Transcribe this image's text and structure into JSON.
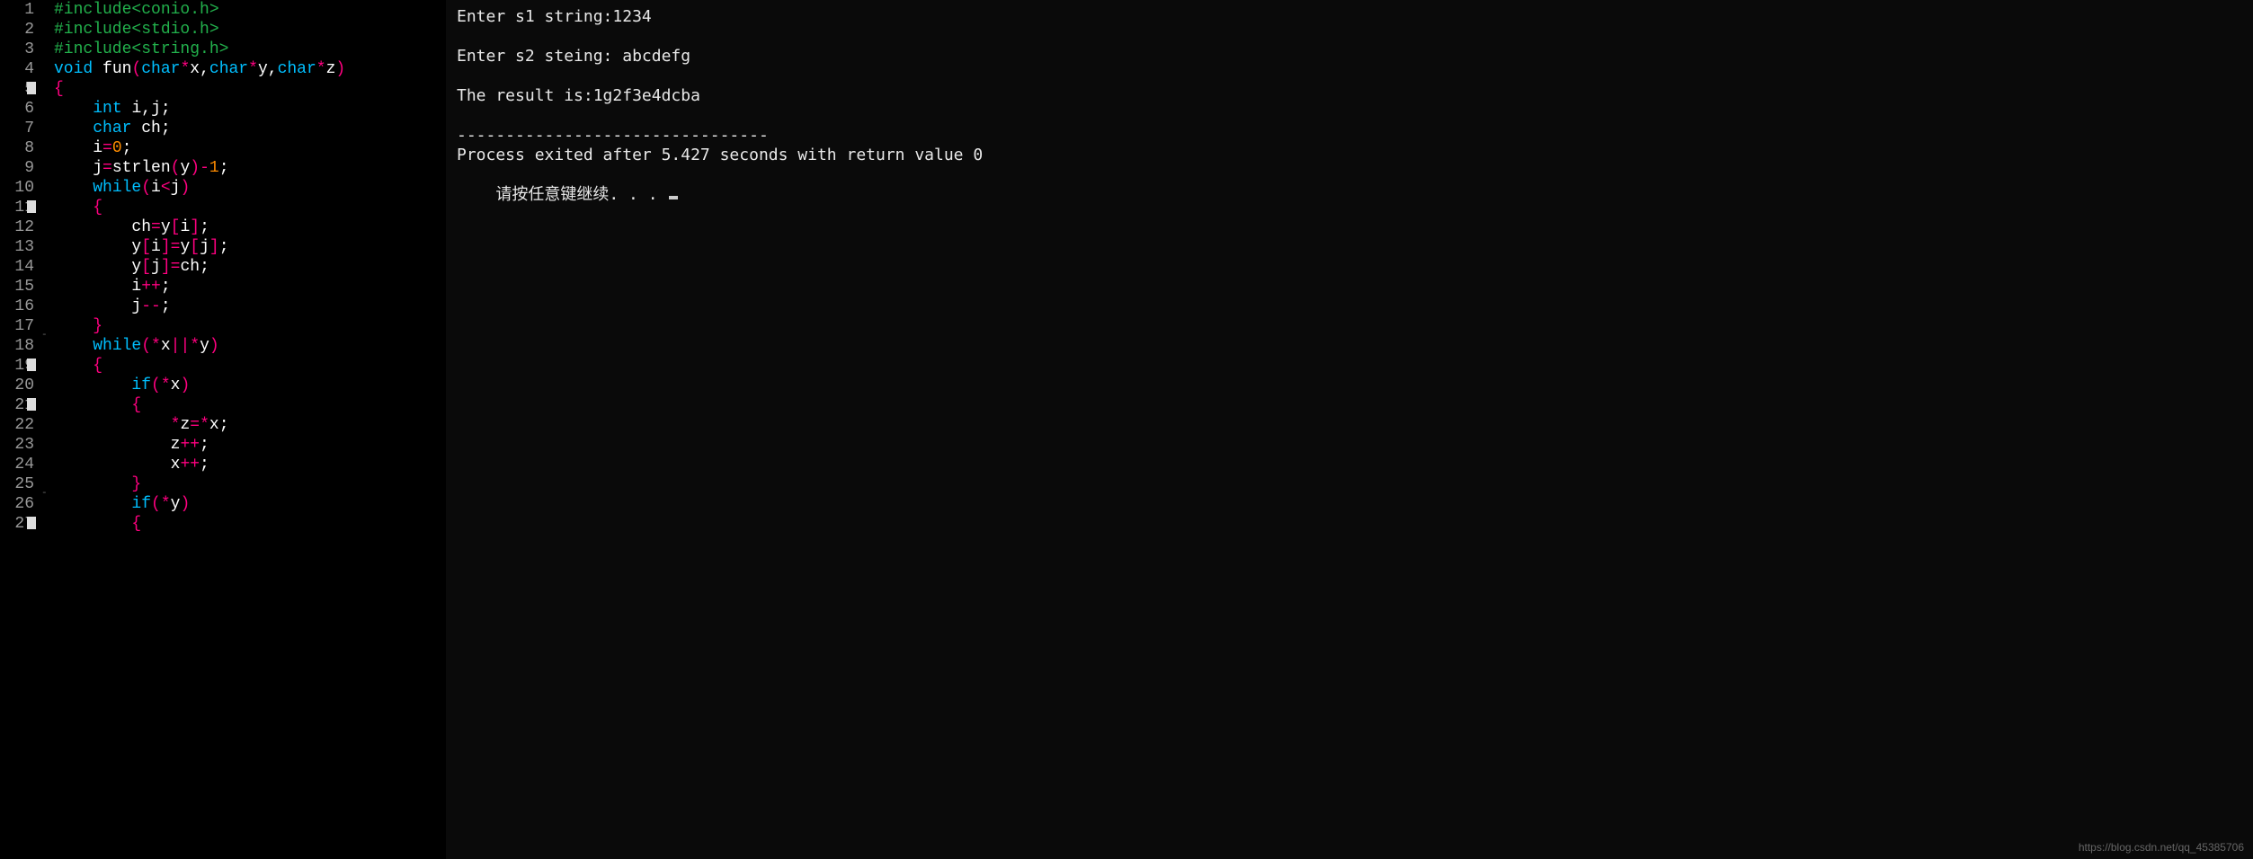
{
  "editor": {
    "lines": [
      {
        "num": "1",
        "tokens": [
          [
            "tok-preproc",
            "#include"
          ],
          [
            "tok-preproc-lib",
            "<conio.h>"
          ]
        ]
      },
      {
        "num": "2",
        "tokens": [
          [
            "tok-preproc",
            "#include"
          ],
          [
            "tok-preproc-lib",
            "<stdio.h>"
          ]
        ]
      },
      {
        "num": "3",
        "tokens": [
          [
            "tok-preproc",
            "#include"
          ],
          [
            "tok-preproc-lib",
            "<string.h>"
          ]
        ]
      },
      {
        "num": "4",
        "tokens": [
          [
            "tok-keyword",
            "void"
          ],
          [
            "",
            " "
          ],
          [
            "tok-func",
            "fun"
          ],
          [
            "tok-bracket",
            "("
          ],
          [
            "tok-type",
            "char"
          ],
          [
            "tok-op",
            "*"
          ],
          [
            "tok-ident",
            "x"
          ],
          [
            "tok-punct",
            ","
          ],
          [
            "tok-type",
            "char"
          ],
          [
            "tok-op",
            "*"
          ],
          [
            "tok-ident",
            "y"
          ],
          [
            "tok-punct",
            ","
          ],
          [
            "tok-type",
            "char"
          ],
          [
            "tok-op",
            "*"
          ],
          [
            "tok-ident",
            "z"
          ],
          [
            "tok-bracket",
            ")"
          ]
        ]
      },
      {
        "num": "5",
        "fold": true,
        "tokens": [
          [
            "tok-bracket",
            "{"
          ]
        ]
      },
      {
        "num": "6",
        "tokens": [
          [
            "",
            "    "
          ],
          [
            "tok-type",
            "int"
          ],
          [
            "",
            " "
          ],
          [
            "tok-ident",
            "i"
          ],
          [
            "tok-punct",
            ","
          ],
          [
            "tok-ident",
            "j"
          ],
          [
            "tok-punct",
            ";"
          ]
        ]
      },
      {
        "num": "7",
        "tokens": [
          [
            "",
            "    "
          ],
          [
            "tok-type",
            "char"
          ],
          [
            "",
            " "
          ],
          [
            "tok-ident",
            "ch"
          ],
          [
            "tok-punct",
            ";"
          ]
        ]
      },
      {
        "num": "8",
        "tokens": [
          [
            "",
            "    "
          ],
          [
            "tok-ident",
            "i"
          ],
          [
            "tok-op",
            "="
          ],
          [
            "tok-num",
            "0"
          ],
          [
            "tok-punct",
            ";"
          ]
        ]
      },
      {
        "num": "9",
        "tokens": [
          [
            "",
            "    "
          ],
          [
            "tok-ident",
            "j"
          ],
          [
            "tok-op",
            "="
          ],
          [
            "tok-func",
            "strlen"
          ],
          [
            "tok-bracket",
            "("
          ],
          [
            "tok-ident",
            "y"
          ],
          [
            "tok-bracket",
            ")"
          ],
          [
            "tok-op",
            "-"
          ],
          [
            "tok-num",
            "1"
          ],
          [
            "tok-punct",
            ";"
          ]
        ]
      },
      {
        "num": "10",
        "tokens": [
          [
            "",
            "    "
          ],
          [
            "tok-keyword",
            "while"
          ],
          [
            "tok-bracket",
            "("
          ],
          [
            "tok-ident",
            "i"
          ],
          [
            "tok-op",
            "<"
          ],
          [
            "tok-ident",
            "j"
          ],
          [
            "tok-bracket",
            ")"
          ]
        ]
      },
      {
        "num": "11",
        "fold": true,
        "tokens": [
          [
            "",
            "    "
          ],
          [
            "tok-bracket",
            "{"
          ]
        ]
      },
      {
        "num": "12",
        "tokens": [
          [
            "",
            "        "
          ],
          [
            "tok-ident",
            "ch"
          ],
          [
            "tok-op",
            "="
          ],
          [
            "tok-ident",
            "y"
          ],
          [
            "tok-bracket",
            "["
          ],
          [
            "tok-ident",
            "i"
          ],
          [
            "tok-bracket",
            "]"
          ],
          [
            "tok-punct",
            ";"
          ]
        ]
      },
      {
        "num": "13",
        "tokens": [
          [
            "",
            "        "
          ],
          [
            "tok-ident",
            "y"
          ],
          [
            "tok-bracket",
            "["
          ],
          [
            "tok-ident",
            "i"
          ],
          [
            "tok-bracket",
            "]"
          ],
          [
            "tok-op",
            "="
          ],
          [
            "tok-ident",
            "y"
          ],
          [
            "tok-bracket",
            "["
          ],
          [
            "tok-ident",
            "j"
          ],
          [
            "tok-bracket",
            "]"
          ],
          [
            "tok-punct",
            ";"
          ]
        ]
      },
      {
        "num": "14",
        "tokens": [
          [
            "",
            "        "
          ],
          [
            "tok-ident",
            "y"
          ],
          [
            "tok-bracket",
            "["
          ],
          [
            "tok-ident",
            "j"
          ],
          [
            "tok-bracket",
            "]"
          ],
          [
            "tok-op",
            "="
          ],
          [
            "tok-ident",
            "ch"
          ],
          [
            "tok-punct",
            ";"
          ]
        ]
      },
      {
        "num": "15",
        "tokens": [
          [
            "",
            "        "
          ],
          [
            "tok-ident",
            "i"
          ],
          [
            "tok-op",
            "++"
          ],
          [
            "tok-punct",
            ";"
          ]
        ]
      },
      {
        "num": "16",
        "tokens": [
          [
            "",
            "        "
          ],
          [
            "tok-ident",
            "j"
          ],
          [
            "tok-op",
            "--"
          ],
          [
            "tok-punct",
            ";"
          ]
        ]
      },
      {
        "num": "17",
        "dash": true,
        "tokens": [
          [
            "",
            "    "
          ],
          [
            "tok-bracket",
            "}"
          ]
        ]
      },
      {
        "num": "18",
        "tokens": [
          [
            "",
            "    "
          ],
          [
            "tok-keyword",
            "while"
          ],
          [
            "tok-bracket",
            "("
          ],
          [
            "tok-op",
            "*"
          ],
          [
            "tok-ident",
            "x"
          ],
          [
            "tok-op",
            "||"
          ],
          [
            "tok-op",
            "*"
          ],
          [
            "tok-ident",
            "y"
          ],
          [
            "tok-bracket",
            ")"
          ]
        ]
      },
      {
        "num": "19",
        "fold": true,
        "tokens": [
          [
            "",
            "    "
          ],
          [
            "tok-bracket",
            "{"
          ]
        ]
      },
      {
        "num": "20",
        "tokens": [
          [
            "",
            "        "
          ],
          [
            "tok-keyword",
            "if"
          ],
          [
            "tok-bracket",
            "("
          ],
          [
            "tok-op",
            "*"
          ],
          [
            "tok-ident",
            "x"
          ],
          [
            "tok-bracket",
            ")"
          ]
        ]
      },
      {
        "num": "21",
        "fold": true,
        "tokens": [
          [
            "",
            "        "
          ],
          [
            "tok-bracket",
            "{"
          ]
        ]
      },
      {
        "num": "22",
        "tokens": [
          [
            "",
            "            "
          ],
          [
            "tok-op",
            "*"
          ],
          [
            "tok-ident",
            "z"
          ],
          [
            "tok-op",
            "="
          ],
          [
            "tok-op",
            "*"
          ],
          [
            "tok-ident",
            "x"
          ],
          [
            "tok-punct",
            ";"
          ]
        ]
      },
      {
        "num": "23",
        "tokens": [
          [
            "",
            "            "
          ],
          [
            "tok-ident",
            "z"
          ],
          [
            "tok-op",
            "++"
          ],
          [
            "tok-punct",
            ";"
          ]
        ]
      },
      {
        "num": "24",
        "tokens": [
          [
            "",
            "            "
          ],
          [
            "tok-ident",
            "x"
          ],
          [
            "tok-op",
            "++"
          ],
          [
            "tok-punct",
            ";"
          ]
        ]
      },
      {
        "num": "25",
        "dash": true,
        "tokens": [
          [
            "",
            "        "
          ],
          [
            "tok-bracket",
            "}"
          ]
        ]
      },
      {
        "num": "26",
        "tokens": [
          [
            "",
            "        "
          ],
          [
            "tok-keyword",
            "if"
          ],
          [
            "tok-bracket",
            "("
          ],
          [
            "tok-op",
            "*"
          ],
          [
            "tok-ident",
            "y"
          ],
          [
            "tok-bracket",
            ")"
          ]
        ]
      },
      {
        "num": "27",
        "fold": true,
        "tokens": [
          [
            "",
            "        "
          ],
          [
            "tok-bracket",
            "{"
          ]
        ]
      }
    ]
  },
  "console": {
    "lines": [
      "Enter s1 string:1234",
      "",
      "Enter s2 steing: abcdefg",
      "",
      "The result is:1g2f3e4dcba",
      "",
      "--------------------------------",
      "Process exited after 5.427 seconds with return value 0"
    ],
    "prompt_text": "请按任意键继续. . . "
  },
  "watermark": "https://blog.csdn.net/qq_45385706"
}
